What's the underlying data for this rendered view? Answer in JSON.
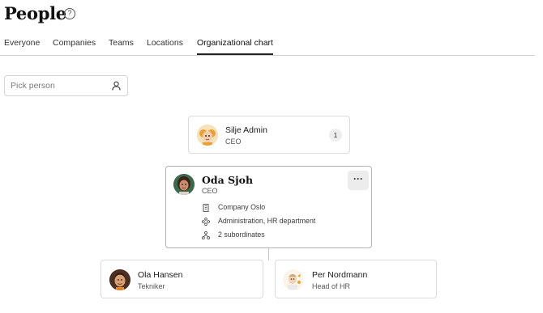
{
  "header": {
    "title": "People",
    "help_icon": "question-circle-icon"
  },
  "tabs": [
    {
      "label": "Everyone",
      "active": false
    },
    {
      "label": "Companies",
      "active": false
    },
    {
      "label": "Teams",
      "active": false
    },
    {
      "label": "Locations",
      "active": false
    },
    {
      "label": "Organizational chart",
      "active": true
    }
  ],
  "picker": {
    "placeholder": "Pick person",
    "icon": "person-icon"
  },
  "org_chart": {
    "manager": {
      "name": "Silje Admin",
      "role": "CEO",
      "count": "1"
    },
    "selected": {
      "name": "Oda Sjoh",
      "role": "CEO",
      "company": "Company Oslo",
      "departments": "Administration, HR department",
      "subordinates": "2 subordinates",
      "menu_label": "···"
    },
    "subordinates": [
      {
        "name": "Ola Hansen",
        "role": "Tekniker"
      },
      {
        "name": "Per Nordmann",
        "role": "Head of HR"
      }
    ]
  },
  "colors": {
    "active_tab_underline": "#222222",
    "card_border": "#dcdcdc",
    "selected_card_border": "#b3b3b3",
    "badge_bg": "#eeeeee"
  }
}
